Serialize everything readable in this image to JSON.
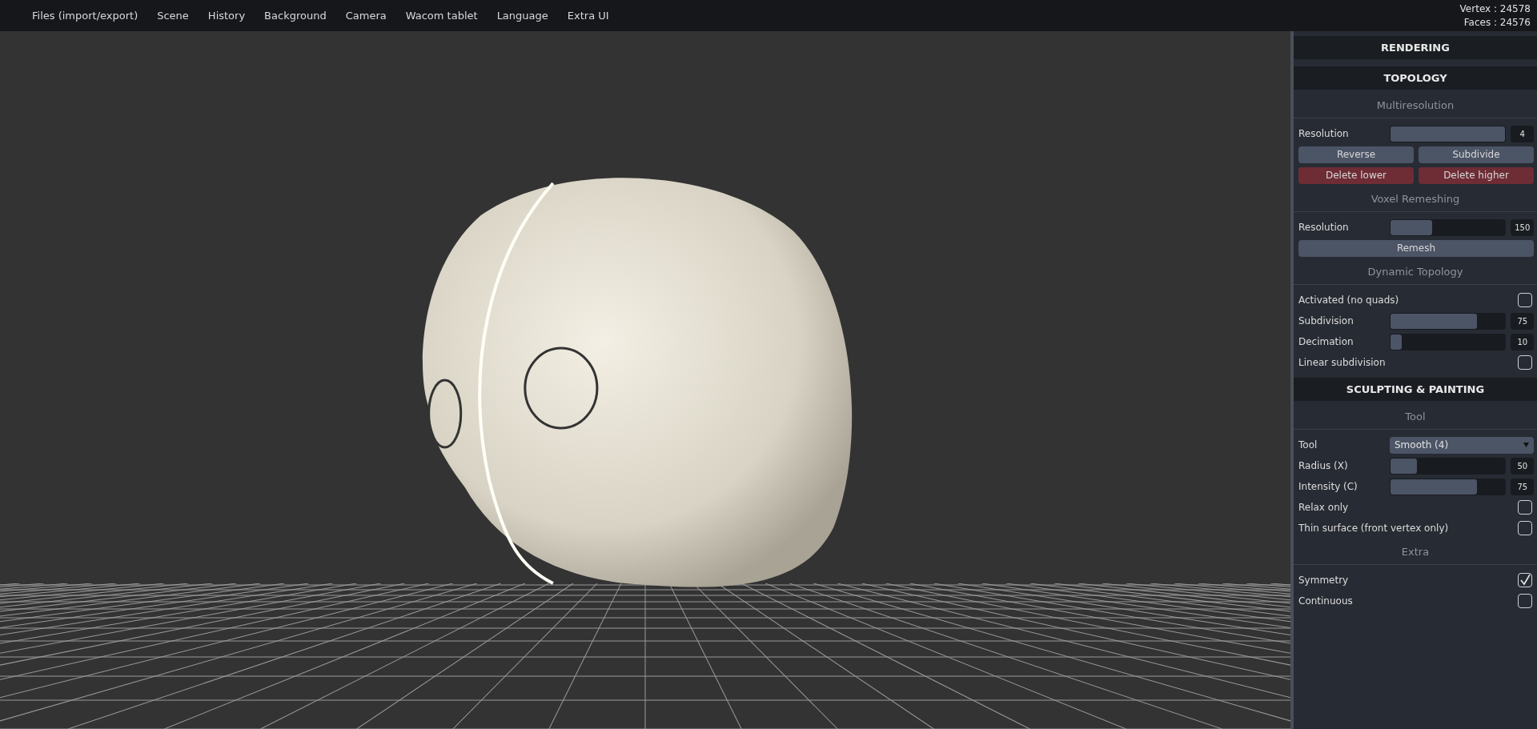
{
  "menu": [
    "Files (import/export)",
    "Scene",
    "History",
    "Background",
    "Camera",
    "Wacom tablet",
    "Language",
    "Extra UI"
  ],
  "stats": [
    "Vertex : 24578",
    "Faces : 24576"
  ],
  "panel": [
    {
      "title": "RENDERING"
    },
    {
      "title": "TOPOLOGY",
      "groups": [
        {
          "title": "Multiresolution",
          "rows": [
            {
              "kind": "slider",
              "label": "Resolution",
              "level": 1,
              "value": "4"
            },
            {
              "kind": "buttons",
              "buttons": [
                {
                  "label": "Reverse",
                  "color": "#4c5566"
                },
                {
                  "label": "Subdivide",
                  "color": "#4c5566"
                }
              ]
            },
            {
              "kind": "buttons",
              "buttons": [
                {
                  "label": "Delete lower",
                  "color": "#6e2c35"
                },
                {
                  "label": "Delete higher",
                  "color": "#6e2c35"
                }
              ]
            }
          ]
        },
        {
          "title": "Voxel Remeshing",
          "rows": [
            {
              "kind": "slider",
              "label": "Resolution",
              "level": 0.36,
              "value": "150"
            },
            {
              "kind": "buttons",
              "buttons": [
                {
                  "label": "Remesh",
                  "color": "#4c5566"
                }
              ]
            }
          ]
        },
        {
          "title": "Dynamic Topology",
          "rows": [
            {
              "kind": "checkbox",
              "label": "Activated (no quads)",
              "checked": false
            },
            {
              "kind": "slider",
              "label": "Subdivision",
              "level": 0.75,
              "value": "75"
            },
            {
              "kind": "slider",
              "label": "Decimation",
              "level": 0.1,
              "value": "10"
            },
            {
              "kind": "checkbox",
              "label": "Linear subdivision",
              "checked": false
            }
          ]
        }
      ]
    },
    {
      "title": "SCULPTING & PAINTING",
      "groups": [
        {
          "title": "Tool",
          "rows": [
            {
              "kind": "select",
              "label": "Tool",
              "value": "Smooth (4)"
            },
            {
              "kind": "slider",
              "label": "Radius (X)",
              "level": 0.23,
              "value": "50"
            },
            {
              "kind": "slider",
              "label": "Intensity (C)",
              "level": 0.75,
              "value": "75"
            },
            {
              "kind": "checkbox",
              "label": "Relax only",
              "checked": false
            },
            {
              "kind": "checkbox",
              "label": "Thin surface (front vertex only)",
              "checked": false
            }
          ]
        },
        {
          "title": "Extra",
          "rows": [
            {
              "kind": "checkbox",
              "label": "Symmetry",
              "checked": true
            },
            {
              "kind": "checkbox",
              "label": "Continuous",
              "checked": false
            }
          ]
        }
      ]
    }
  ]
}
